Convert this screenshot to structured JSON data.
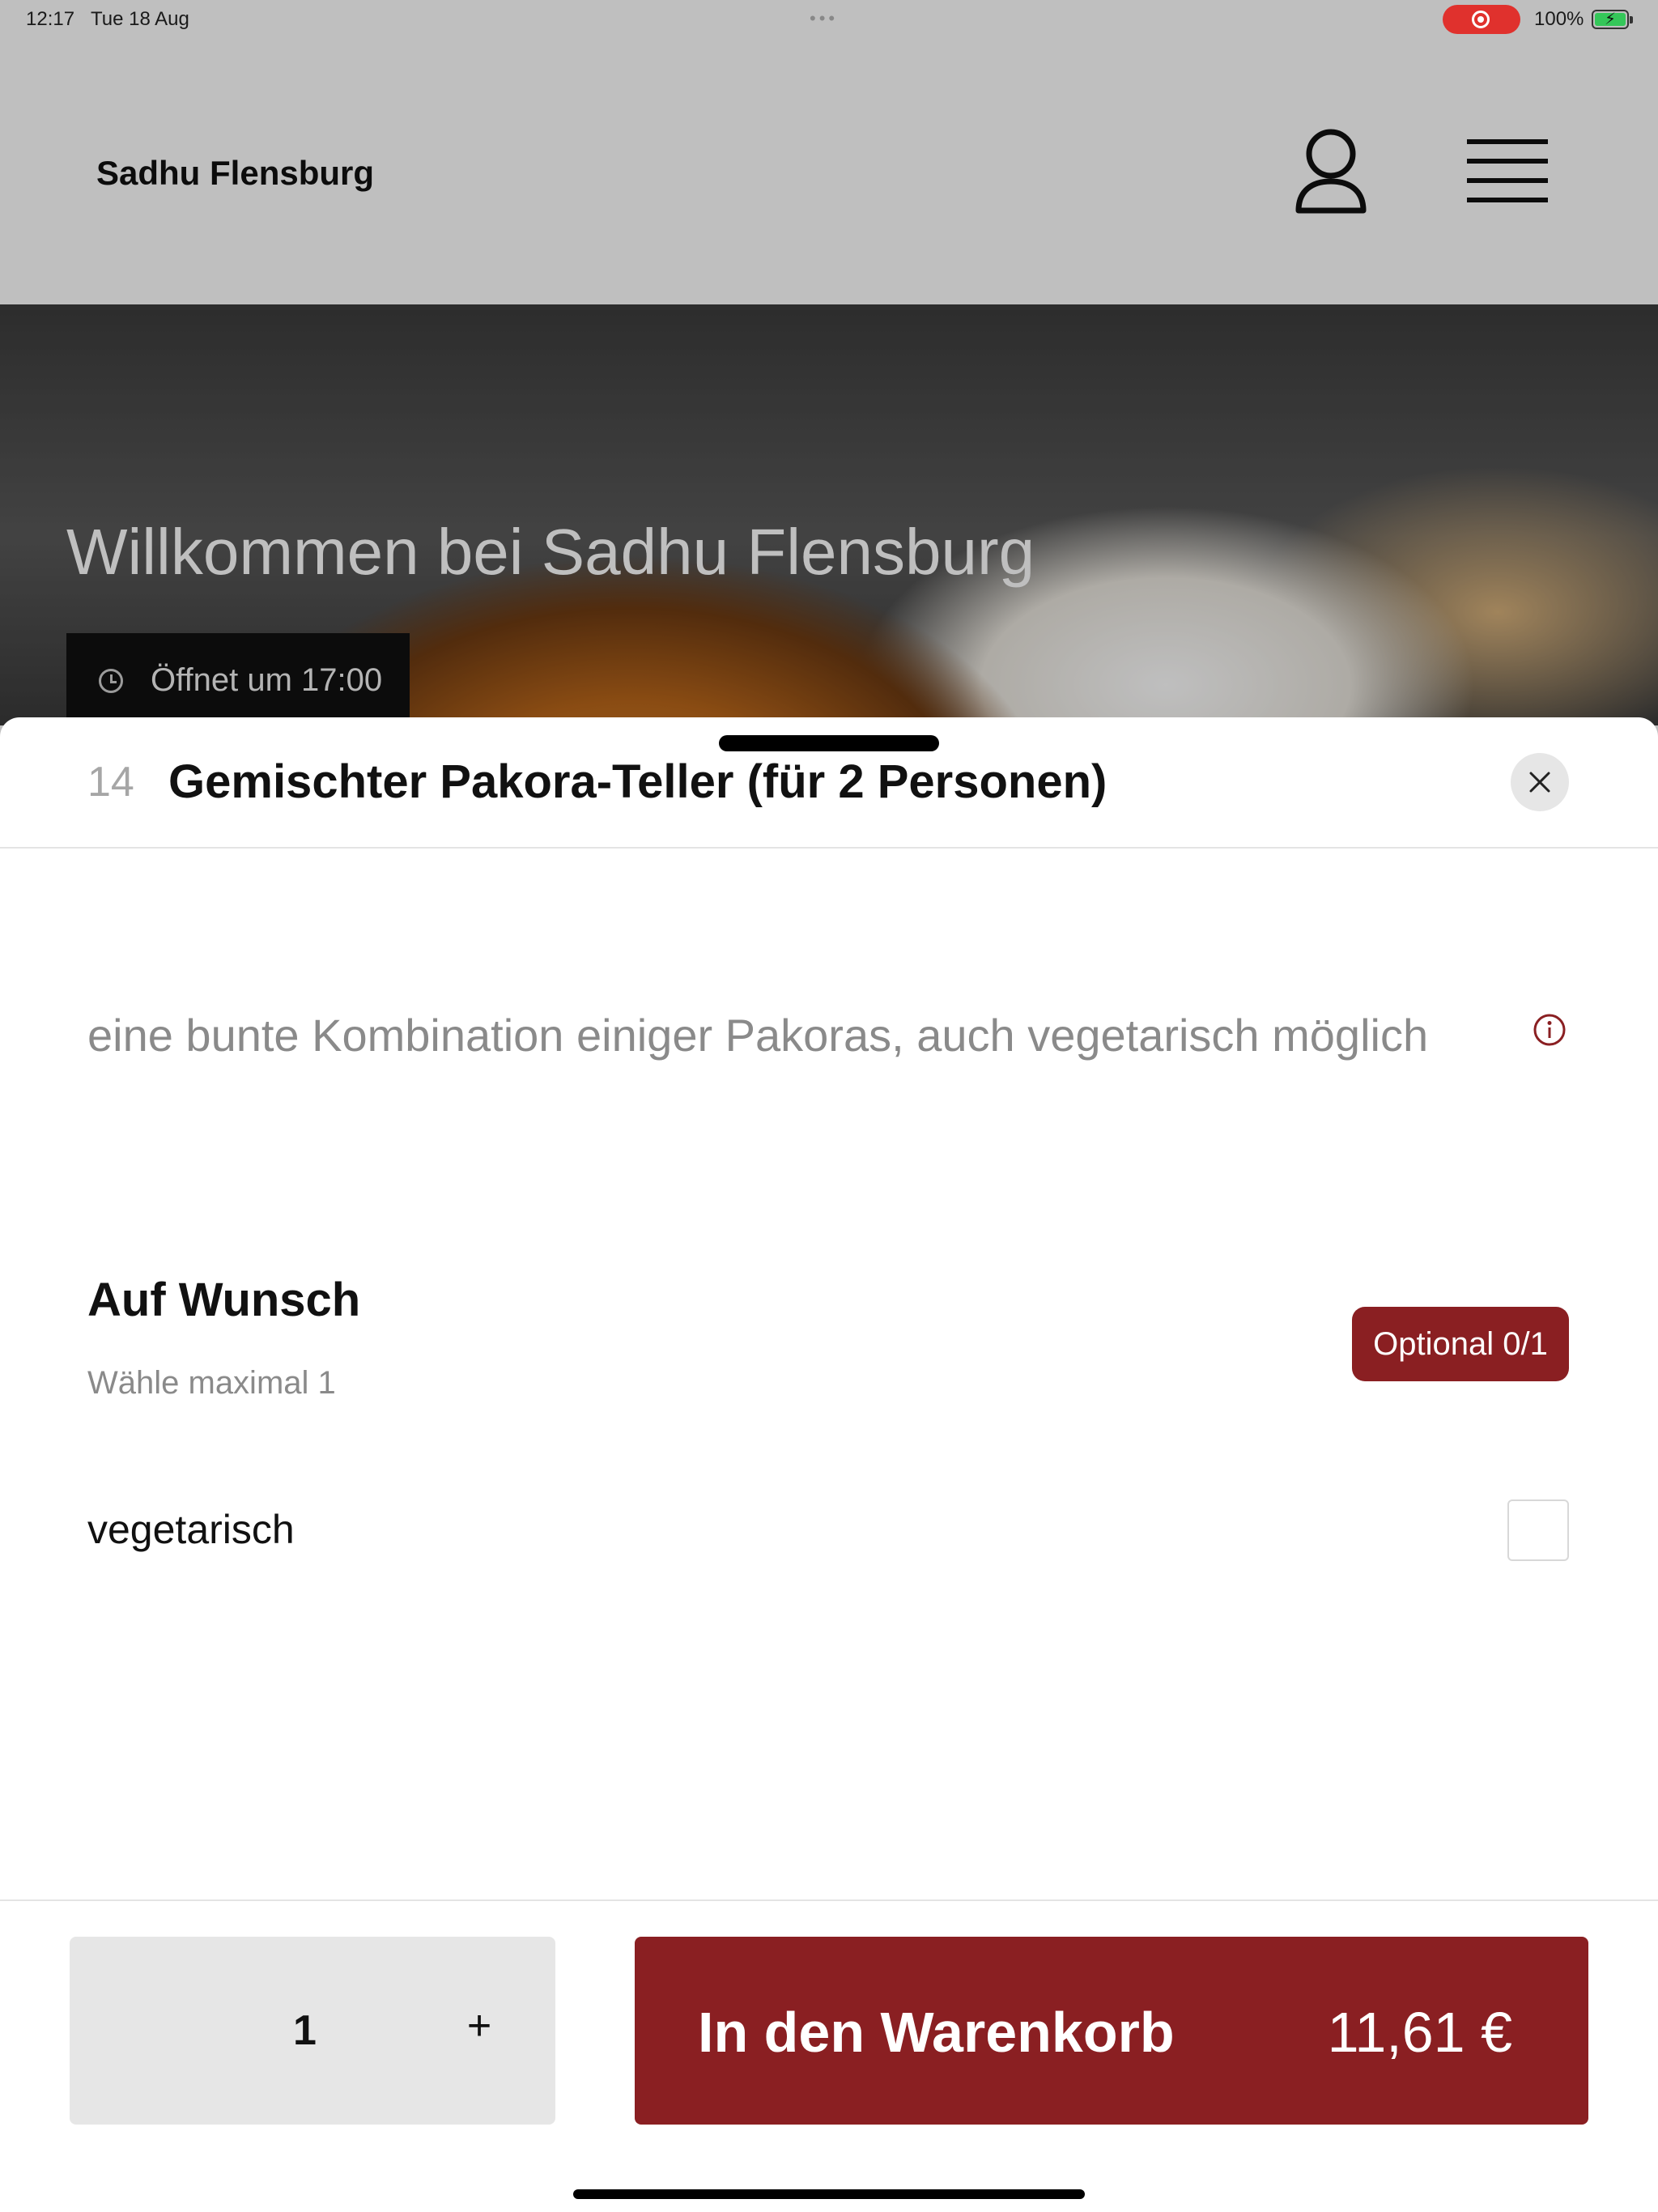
{
  "status_bar": {
    "time": "12:17",
    "date": "Tue 18 Aug",
    "battery_percent": "100%"
  },
  "header": {
    "brand": "Sadhu Flensburg",
    "user_icon": "user-icon",
    "menu_icon": "hamburger-menu-icon"
  },
  "hero": {
    "title": "Willkommen bei Sadhu Flensburg",
    "opening": "Öffnet um 17:00",
    "clock_icon": "clock-icon"
  },
  "item": {
    "number": "14",
    "title": "Gemischter Pakora-Teller (für 2 Personen)",
    "description": "eine bunte Kombination einiger Pakoras, auch vegetarisch möglich",
    "info_icon": "info-icon",
    "close_icon": "close-icon"
  },
  "options_group": {
    "title": "Auf Wunsch",
    "subtitle": "Wähle maximal 1",
    "badge": "Optional 0/1",
    "options": [
      {
        "label": "vegetarisch",
        "checked": false
      }
    ]
  },
  "footer": {
    "quantity": "1",
    "plus": "+",
    "cart_label": "In den Warenkorb",
    "price": "11,61 €"
  },
  "colors": {
    "accent": "#8a1f22",
    "muted_text": "#8a8a8a",
    "qty_background": "#e6e6e6",
    "recording_indicator": "#e0312d",
    "battery_fill": "#34c759"
  }
}
